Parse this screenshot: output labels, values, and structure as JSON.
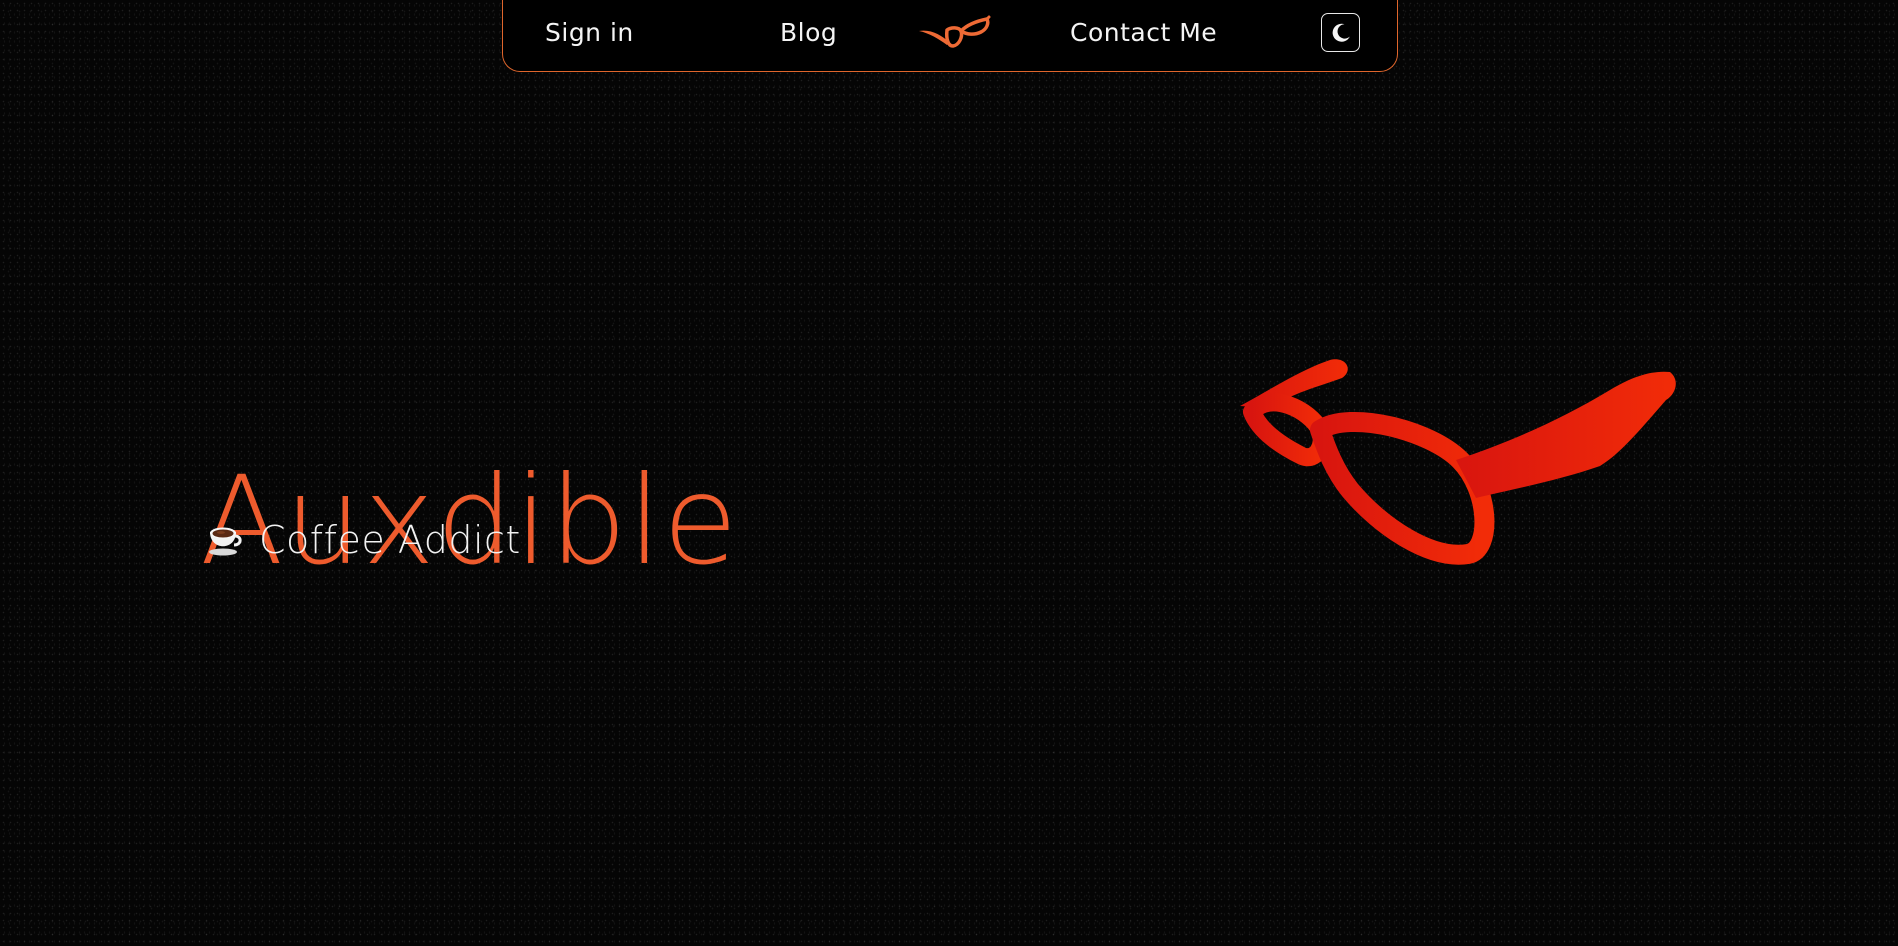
{
  "nav": {
    "signin_label": "Sign in",
    "blog_label": "Blog",
    "contact_label": "Contact Me",
    "logo_icon": "glasses-icon",
    "theme_toggle_icon": "moon-icon"
  },
  "hero": {
    "title": "Auxdible",
    "subtitle": "Coffee Addict",
    "subtitle_icon": "coffee-cup-icon",
    "art_icon": "glasses-illustration"
  },
  "colors": {
    "accent": "#ee5b2d",
    "nav_border": "#e0662c",
    "background": "#050505",
    "art_red": "#e21a10"
  }
}
